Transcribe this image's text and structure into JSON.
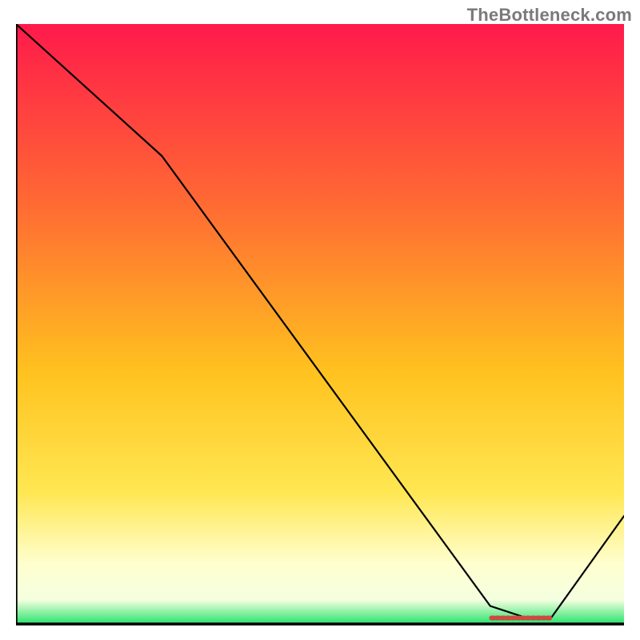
{
  "attribution": "TheBottleneck.com",
  "colors": {
    "gradient_top": "#ff1a4b",
    "gradient_mid1": "#ff7a2e",
    "gradient_mid2": "#ffd21f",
    "gradient_lightband": "#ffffcf",
    "gradient_bottom": "#26e36a",
    "axis": "#000000",
    "curve": "#000000",
    "marker": "#cc4b43",
    "attribution_text": "#7a7a7a"
  },
  "chart_data": {
    "type": "line",
    "title": "",
    "xlabel": "",
    "ylabel": "",
    "xlim": [
      0,
      100
    ],
    "ylim": [
      0,
      100
    ],
    "series": [
      {
        "name": "bottleneck-curve",
        "x": [
          0,
          24,
          78,
          84,
          88,
          100
        ],
        "values": [
          100,
          78,
          3,
          1,
          1,
          18
        ]
      }
    ],
    "annotations": [
      {
        "type": "optimal-range-marker",
        "x_start": 78,
        "x_end": 88,
        "y": 1
      }
    ]
  }
}
